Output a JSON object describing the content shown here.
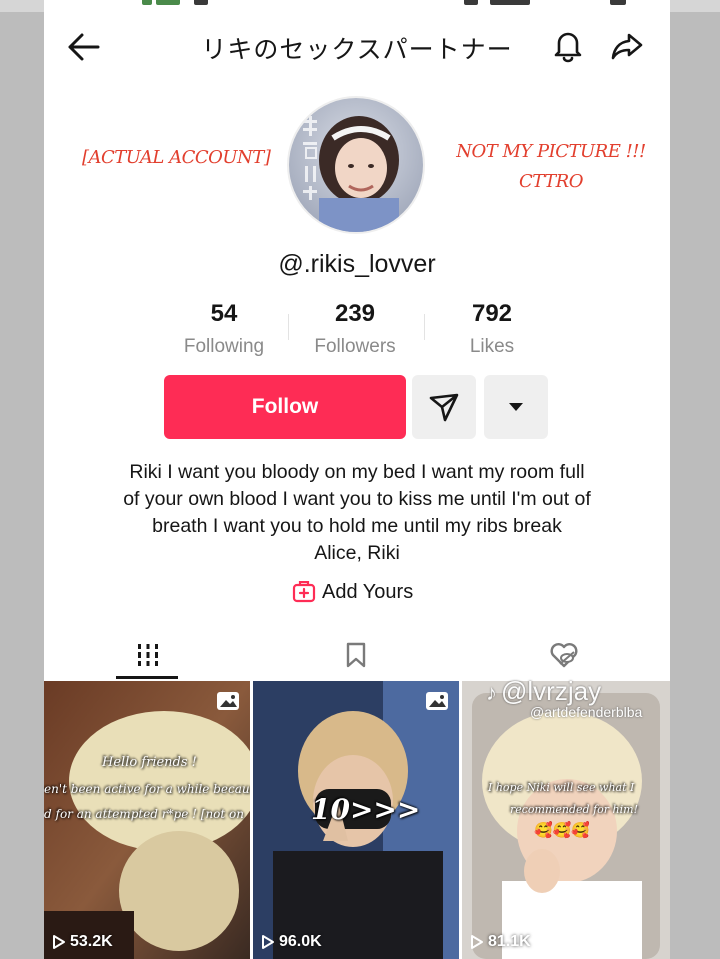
{
  "header": {
    "title": "リキのセックスパートナー",
    "back_icon": "arrow-left-icon",
    "bell_icon": "bell-icon",
    "share_icon": "share-arrow-icon"
  },
  "captions": {
    "left": "[ACTUAL ACCOUNT]",
    "right_line1": "NOT MY PICTURE !!!",
    "right_line2": "CTTRO"
  },
  "profile": {
    "username": "@.rikis_lovver",
    "avatar_lettering": "吉村リセ"
  },
  "stats": [
    {
      "value": "54",
      "label": "Following"
    },
    {
      "value": "239",
      "label": "Followers"
    },
    {
      "value": "792",
      "label": "Likes"
    }
  ],
  "actions": {
    "follow_label": "Follow",
    "follow_color": "#fe2c55",
    "message_icon": "send-icon",
    "more_icon": "caret-down-icon"
  },
  "bio": {
    "lines": [
      "Riki I want you bloody on my bed I want my room full",
      "of your own blood I want you to kiss me until I'm out of",
      "breath I want you to hold me until my ribs break",
      "Alice, Riki"
    ]
  },
  "add_yours": {
    "label": "Add Yours",
    "icon": "add-yours-icon"
  },
  "tabs": [
    {
      "name": "videos",
      "icon": "grid-icon",
      "active": true
    },
    {
      "name": "saved",
      "icon": "bookmark-icon",
      "active": false
    },
    {
      "name": "liked",
      "icon": "heart-hidden-icon",
      "active": false
    }
  ],
  "videos": [
    {
      "views": "53.2K",
      "overlay_lines": [
        "Hello friends !",
        "en't been active for a while because",
        "d for an attempted r*pe ! [not on"
      ],
      "has_photo_icon": true
    },
    {
      "views": "96.0K",
      "overlay_lines": [
        "10>>>"
      ],
      "has_photo_icon": true
    },
    {
      "views": "81.1K",
      "overlay_lines": [
        "I hope Niki will see what I",
        "recommended for him!",
        "🥰🥰🥰"
      ],
      "has_photo_icon": false
    }
  ],
  "watermark": {
    "main": "@lvrzjay",
    "sub": "@artdefenderblba"
  }
}
